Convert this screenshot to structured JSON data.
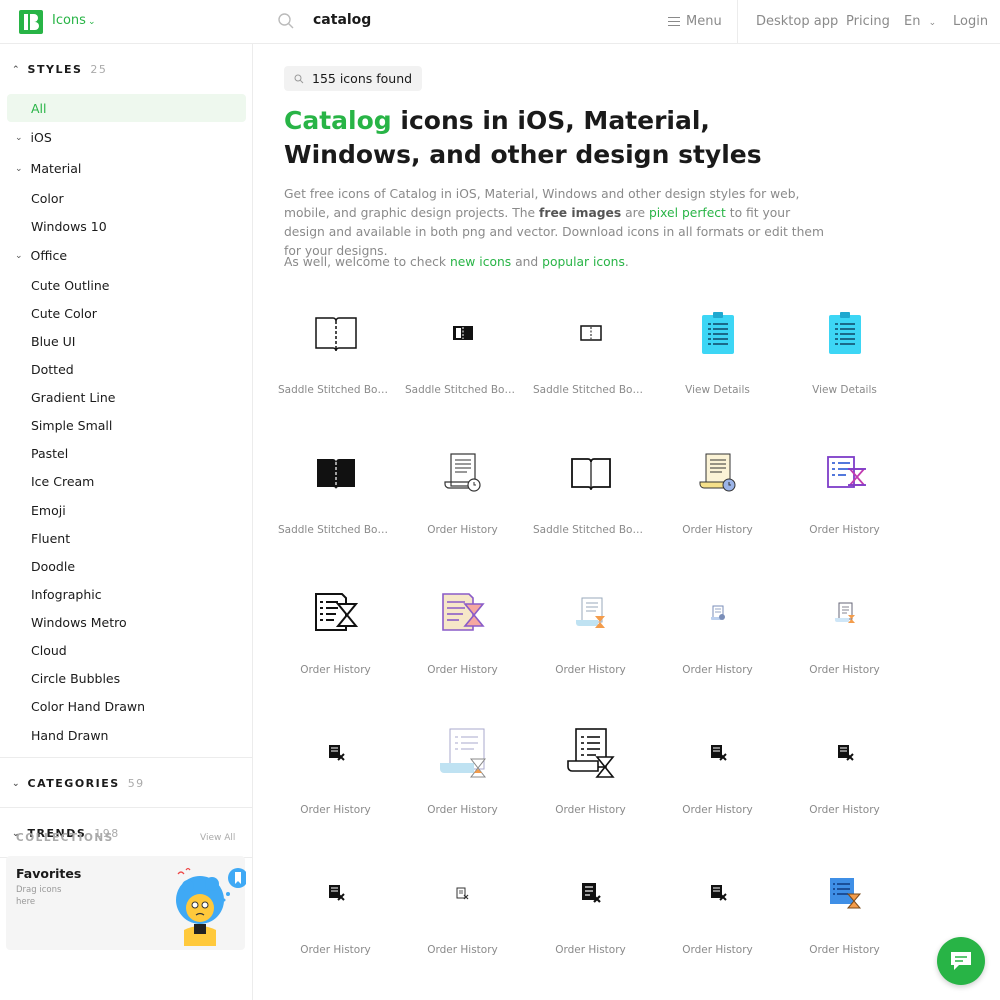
{
  "header": {
    "brand": "Icons",
    "search_value": "catalog",
    "menu_label": "Menu",
    "links": [
      "Desktop app",
      "Pricing",
      "En",
      "Login"
    ]
  },
  "sidebar": {
    "styles_title": "STYLES",
    "styles_count": "25",
    "items": {
      "all": "All",
      "ios": "iOS",
      "material": "Material",
      "color": "Color",
      "windows10": "Windows 10",
      "office": "Office",
      "cute_outline": "Cute Outline",
      "cute_color": "Cute Color",
      "blue_ui": "Blue UI",
      "dotted": "Dotted",
      "gradient_line": "Gradient Line",
      "simple_small": "Simple Small",
      "pastel": "Pastel",
      "ice_cream": "Ice Cream",
      "emoji": "Emoji",
      "fluent": "Fluent",
      "doodle": "Doodle",
      "infographic": "Infographic",
      "windows_metro": "Windows Metro",
      "cloud": "Cloud",
      "circle_bubbles": "Circle Bubbles",
      "color_hand_drawn": "Color Hand Drawn",
      "hand_drawn": "Hand Drawn"
    },
    "categories_title": "CATEGORIES",
    "categories_count": "59",
    "trends_title": "TRENDS",
    "trends_count": "198",
    "collections_title": "COLLECTIONS",
    "view_all": "View All",
    "favorites_title": "Favorites",
    "favorites_desc": "Drag icons here"
  },
  "main": {
    "found": "155 icons found",
    "title_highlight": "Catalog",
    "title_rest": " icons in iOS, Material, Windows, and other design styles",
    "desc_1": "Get free icons of Catalog in iOS, Material, Windows and other design styles for web, mobile, and graphic design projects. The ",
    "desc_bold": "free images",
    "desc_2": " are ",
    "desc_link": "pixel perfect",
    "desc_3": " to fit your design and available in both png and vector. Download icons in all formats or edit them for your designs.",
    "welcome_1": "As well, welcome to check ",
    "welcome_link1": "new icons",
    "welcome_2": " and ",
    "welcome_link2": "popular icons",
    "welcome_3": "."
  },
  "icons": [
    {
      "caption": "Saddle Stitched Boo...",
      "icon": "book-outline-icon"
    },
    {
      "caption": "Saddle Stitched Boo...",
      "icon": "book-small-filled-icon"
    },
    {
      "caption": "Saddle Stitched Boo...",
      "icon": "book-small-outline-icon"
    },
    {
      "caption": "View Details",
      "icon": "clipboard-list-cyan-icon"
    },
    {
      "caption": "View Details",
      "icon": "clipboard-list-cyan-icon"
    },
    {
      "caption": "Saddle Stitched Boo...",
      "icon": "book-filled-icon"
    },
    {
      "caption": "Order History",
      "icon": "receipt-clock-outline-icon"
    },
    {
      "caption": "Saddle Stitched Boo...",
      "icon": "book-outline-icon"
    },
    {
      "caption": "Order History",
      "icon": "receipt-clock-color-icon"
    },
    {
      "caption": "Order History",
      "icon": "list-hourglass-gradient-icon"
    },
    {
      "caption": "Order History",
      "icon": "list-hourglass-outline-icon"
    },
    {
      "caption": "Order History",
      "icon": "list-hourglass-pastel-icon"
    },
    {
      "caption": "Order History",
      "icon": "receipt-hourglass-blue-icon"
    },
    {
      "caption": "Order History",
      "icon": "receipt-small-icon"
    },
    {
      "caption": "Order History",
      "icon": "receipt-hourglass-small-icon"
    },
    {
      "caption": "Order History",
      "icon": "receipt-x-small-icon"
    },
    {
      "caption": "Order History",
      "icon": "receipt-hourglass-blue-large-icon"
    },
    {
      "caption": "Order History",
      "icon": "receipt-hourglass-outline-large-icon"
    },
    {
      "caption": "Order History",
      "icon": "receipt-x-small-icon"
    },
    {
      "caption": "Order History",
      "icon": "receipt-x-small-icon"
    },
    {
      "caption": "Order History",
      "icon": "receipt-x-small-icon"
    },
    {
      "caption": "Order History",
      "icon": "receipt-x-tiny-icon"
    },
    {
      "caption": "Order History",
      "icon": "receipt-x-filled-icon"
    },
    {
      "caption": "Order History",
      "icon": "receipt-x-small-icon"
    },
    {
      "caption": "Order History",
      "icon": "list-hourglass-color-icon"
    }
  ],
  "colors": {
    "accent": "#28b446",
    "cyan": "#3dd6f5",
    "purple": "#7d3cc8",
    "muted": "#8a8a8a"
  }
}
